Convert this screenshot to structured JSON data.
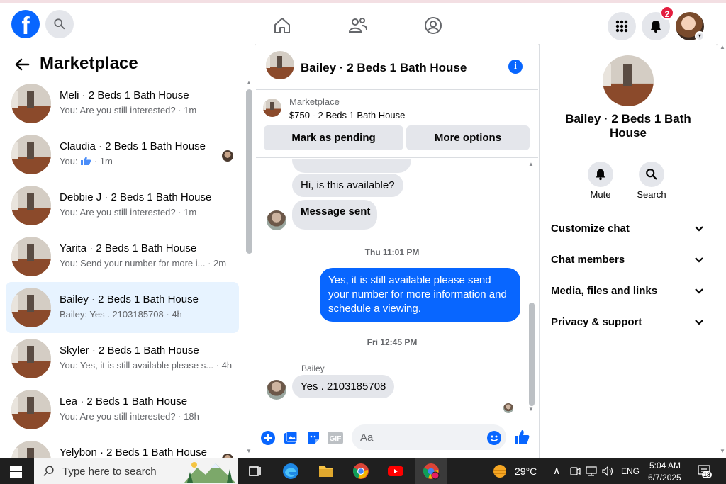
{
  "topbar": {
    "logo": "f",
    "notification_count": "2"
  },
  "left": {
    "title": "Marketplace",
    "conversations": [
      {
        "title": "Meli · 2 Beds 1 Bath House",
        "subtitle": "You: Are you still interested?",
        "time": "· 1m"
      },
      {
        "title": "Claudia · 2 Beds 1 Bath House",
        "subtitle": "You:",
        "time": "· 1m"
      },
      {
        "title": "Debbie J · 2 Beds 1 Bath House",
        "subtitle": "You: Are you still interested?",
        "time": "· 1m"
      },
      {
        "title": "Yarita · 2 Beds 1 Bath House",
        "subtitle": "You: Send your number for more i...",
        "time": "· 2m"
      },
      {
        "title": "Bailey · 2 Beds 1 Bath House",
        "subtitle": "Bailey: Yes . 2103185708",
        "time": "· 4h"
      },
      {
        "title": "Skyler · 2 Beds 1 Bath House",
        "subtitle": "You: Yes, it is still available please s...",
        "time": "· 4h"
      },
      {
        "title": "Lea · 2 Beds 1 Bath House",
        "subtitle": "You: Are you still interested?",
        "time": "· 18h"
      },
      {
        "title": "Yelybon · 2 Beds 1 Bath House",
        "subtitle": "",
        "time": ""
      }
    ]
  },
  "chat": {
    "title": "Bailey · 2 Beds 1 Bath House",
    "listing_category": "Marketplace",
    "listing_price": "$750 - 2 Beds 1 Bath House",
    "mark_pending": "Mark as pending",
    "more_options": "More options",
    "messages": {
      "m1": "Hi, is this available?",
      "m2": "Message sent",
      "ts1": "Thu 11:01 PM",
      "m3": "Yes, it is still available please send your number for more information and schedule a viewing.",
      "ts2": "Fri 12:45 PM",
      "sender": "Bailey",
      "m4": "Yes . 2103185708"
    },
    "input_placeholder": "Aa"
  },
  "right": {
    "title": "Bailey · 2 Beds 1 Bath House",
    "mute": "Mute",
    "search": "Search",
    "rows": [
      "Customize chat",
      "Chat members",
      "Media, files and links",
      "Privacy & support"
    ]
  },
  "taskbar": {
    "search_placeholder": "Type here to search",
    "weather": "29°C",
    "language": "ENG",
    "time": "5:04 AM",
    "date": "6/7/2025",
    "notifications": "18"
  },
  "colors": {
    "brand": "#0866ff",
    "badge": "#e41e3f",
    "active_row": "#e7f3ff"
  }
}
